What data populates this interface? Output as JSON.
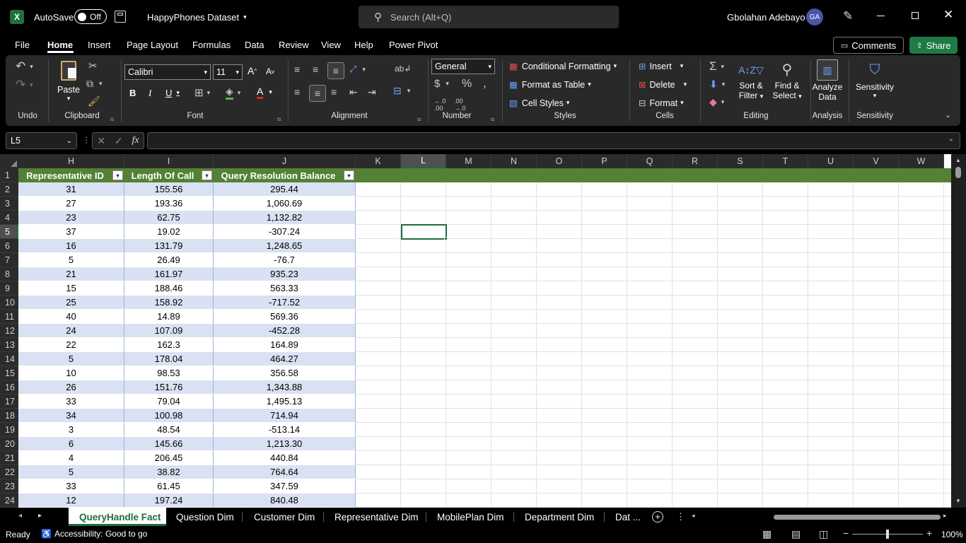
{
  "titlebar": {
    "autosave_label": "AutoSave",
    "autosave_state": "Off",
    "doc_title": "HappyPhones Dataset",
    "search_placeholder": "Search (Alt+Q)",
    "user_name": "Gbolahan Adebayo",
    "user_initials": "GA"
  },
  "menu_tabs": [
    "File",
    "Home",
    "Insert",
    "Page Layout",
    "Formulas",
    "Data",
    "Review",
    "View",
    "Help",
    "Power Pivot"
  ],
  "active_tab": "Home",
  "comments_label": "Comments",
  "share_label": "Share",
  "ribbon": {
    "groups": {
      "undo": "Undo",
      "clipboard": "Clipboard",
      "font": "Font",
      "alignment": "Alignment",
      "number": "Number",
      "styles": "Styles",
      "cells": "Cells",
      "editing": "Editing",
      "analysis": "Analysis",
      "sensitivity": "Sensitivity"
    },
    "paste_label": "Paste",
    "font_name": "Calibri",
    "font_size": "11",
    "number_format": "General",
    "conditional_formatting": "Conditional Formatting",
    "format_as_table": "Format as Table",
    "cell_styles": "Cell Styles",
    "insert": "Insert",
    "delete": "Delete",
    "format": "Format",
    "sort_filter_1": "Sort &",
    "sort_filter_2": "Filter",
    "find_select_1": "Find &",
    "find_select_2": "Select",
    "analyze_data_1": "Analyze",
    "analyze_data_2": "Data",
    "sensitivity_btn": "Sensitivity"
  },
  "formula_bar": {
    "name_box": "L5",
    "formula": ""
  },
  "columns": [
    "H",
    "I",
    "J",
    "K",
    "L",
    "M",
    "N",
    "O",
    "P",
    "Q",
    "R",
    "S",
    "T",
    "U",
    "V",
    "W"
  ],
  "selected_column": "L",
  "selected_row": "5",
  "table": {
    "headers": [
      "Representative ID",
      "Length Of Call",
      "Query Resolution Balance"
    ],
    "rows": [
      [
        "2",
        "31",
        "155.56",
        "295.44"
      ],
      [
        "3",
        "27",
        "193.36",
        "1,060.69"
      ],
      [
        "4",
        "23",
        "62.75",
        "1,132.82"
      ],
      [
        "5",
        "37",
        "19.02",
        "-307.24"
      ],
      [
        "6",
        "16",
        "131.79",
        "1,248.65"
      ],
      [
        "7",
        "5",
        "26.49",
        "-76.7"
      ],
      [
        "8",
        "21",
        "161.97",
        "935.23"
      ],
      [
        "9",
        "15",
        "188.46",
        "563.33"
      ],
      [
        "10",
        "25",
        "158.92",
        "-717.52"
      ],
      [
        "11",
        "40",
        "14.89",
        "569.36"
      ],
      [
        "12",
        "24",
        "107.09",
        "-452.28"
      ],
      [
        "13",
        "22",
        "162.3",
        "164.89"
      ],
      [
        "14",
        "5",
        "178.04",
        "464.27"
      ],
      [
        "15",
        "10",
        "98.53",
        "356.58"
      ],
      [
        "16",
        "26",
        "151.76",
        "1,343.88"
      ],
      [
        "17",
        "33",
        "79.04",
        "1,495.13"
      ],
      [
        "18",
        "34",
        "100.98",
        "714.94"
      ],
      [
        "19",
        "3",
        "48.54",
        "-513.14"
      ],
      [
        "20",
        "6",
        "145.66",
        "1,213.30"
      ],
      [
        "21",
        "4",
        "206.45",
        "440.84"
      ],
      [
        "22",
        "5",
        "38.82",
        "764.64"
      ],
      [
        "23",
        "33",
        "61.45",
        "347.59"
      ],
      [
        "24",
        "12",
        "197.24",
        "840.48"
      ]
    ]
  },
  "sheet_tabs": [
    "QueryHandle Fact",
    "Question Dim",
    "Customer Dim",
    "Representative Dim",
    "MobilePlan Dim",
    "Department Dim",
    "Dat ..."
  ],
  "active_sheet": "QueryHandle Fact",
  "status": {
    "ready": "Ready",
    "accessibility": "Accessibility: Good to go",
    "zoom": "100%"
  },
  "colors": {
    "header_green": "#538135",
    "band_blue": "#d9e1f2",
    "share_green": "#1f7a45",
    "excel_green": "#217346"
  }
}
